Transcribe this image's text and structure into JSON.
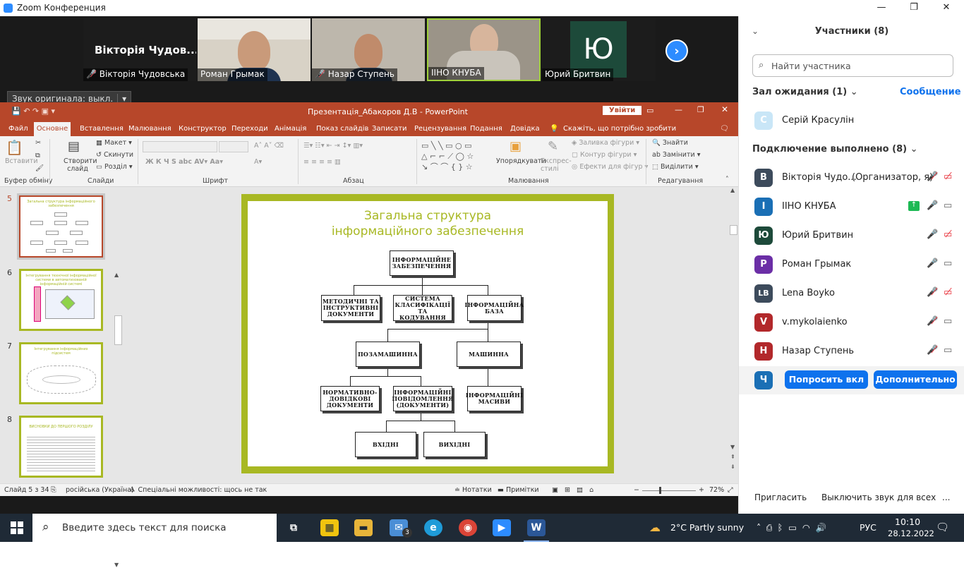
{
  "window": {
    "title": "Zoom Конференция",
    "minimize": "—",
    "restore": "❐",
    "close": "✕"
  },
  "video_strip": {
    "active_name_big": "Вікторія Чудов...",
    "tiles": [
      {
        "label": "Вікторія Чудовська",
        "muted": true
      },
      {
        "label": "Роман Грымак",
        "muted": false
      },
      {
        "label": "Назар Ступень",
        "muted": true
      },
      {
        "label": "ІІНО КНУБА",
        "muted": false
      },
      {
        "label": "Юрий Бритвин",
        "muted": false,
        "initial": "Ю"
      }
    ],
    "next_icon": "›"
  },
  "audio_button": {
    "label": "Звук оригинала: выкл.",
    "dropdown": "▾"
  },
  "ppt": {
    "title": "Презентація_Абакоров Д.В  -  PowerPoint",
    "signin": "Увійти",
    "tabs": [
      "Файл",
      "Основне",
      "Вставлення",
      "Малювання",
      "Конструктор",
      "Переходи",
      "Анімація",
      "Показ слайдів",
      "Записати",
      "Рецензування",
      "Подання",
      "Довідка"
    ],
    "tell_me": "Скажіть, що потрібно зробити",
    "ribbon": {
      "groups": [
        "Буфер обміну",
        "Слайди",
        "Шрифт",
        "Абзац",
        "Малювання",
        "Редагування"
      ],
      "paste": "Вставити",
      "new_slide": "Створити слайд",
      "layout": "Макет",
      "reset": "Скинути",
      "section": "Розділ",
      "arrange": "Упорядкувати",
      "quick_styles": "Експрес-стилі",
      "fill": "Заливка фігури",
      "outline": "Контур фігури",
      "effects": "Ефекти для фігур",
      "find": "Знайти",
      "replace": "Замінити",
      "select": "Виділити"
    },
    "thumbnails": [
      {
        "num": "5",
        "title": "Загальна структура інформаційного забезпечення"
      },
      {
        "num": "6",
        "title": "Інтегрування технічної інформаційної системи в автоматизованій інформаційній системі"
      },
      {
        "num": "7",
        "title": "Інтегрування інформаційних підсистем"
      },
      {
        "num": "8",
        "title": "ВИСНОВКИ ДО ПЕРШОГО РОЗДІЛУ"
      }
    ],
    "slide": {
      "title": "Загальна структура інформаційного забезпечення",
      "nodes": {
        "root": "ІНФОРМАЦІЙНЕ ЗАБЕЗПЕЧЕННЯ",
        "method": "МЕТОДИЧНІ ТА ІНСТРУКТИВНІ ДОКУМЕНТИ",
        "classif": "СИСТЕМА КЛАСИФІКАЦІЇ ТА КОДУВАННЯ",
        "base": "ІНФОРМАЦІЙНА БАЗА",
        "offmach": "ПОЗАМАШИННА",
        "mach": "МАШИННА",
        "norm": "НОРМАТИВНО-ДОВІДКОВІ ДОКУМЕНТИ",
        "msgs": "ІНФОРМАЦІЙНІ ПОВІДОМЛЕННЯ (ДОКУМЕНТИ)",
        "arrays": "ІНФОРМАЦІЙНІ МАСИВИ",
        "in": "ВХІДНІ",
        "out": "ВИХІДНІ"
      }
    },
    "status": {
      "slide": "Слайд 5 з 34",
      "lang": "російська (Україна)",
      "access": "Спеціальні можливості: щось не так",
      "notes": "Нотатки",
      "comments": "Примітки",
      "zoom": "72%"
    }
  },
  "panel": {
    "title": "Участники (8)",
    "search_placeholder": "Найти участника",
    "waiting_label": "Зал ожидания (1)",
    "message_btn": "Сообщение",
    "waiting": [
      {
        "initial": "С",
        "name": "Серій Красулін",
        "color": "#c9e6f7"
      }
    ],
    "connected_label": "Подключение выполнено (8)",
    "participants": [
      {
        "initial": "В",
        "name": "Вікторія Чудо...",
        "role": "(Организатор, я)",
        "color": "#3d4b5c"
      },
      {
        "initial": "І",
        "name": "ІІНО КНУБА",
        "role": "",
        "color": "#1a6fb5"
      },
      {
        "initial": "Ю",
        "name": "Юрий Бритвин",
        "role": "",
        "color": "#1d4a3a"
      },
      {
        "initial": "Р",
        "name": "Роман Грымак",
        "role": "",
        "color": "#6b2ea6"
      },
      {
        "initial": "LB",
        "name": "Lena Boyko",
        "role": "",
        "color": "#3d4b5c"
      },
      {
        "initial": "V",
        "name": "v.mykolaienko",
        "role": "",
        "color": "#b2282b"
      },
      {
        "initial": "Н",
        "name": "Назар Ступень",
        "role": "",
        "color": "#b2282b"
      },
      {
        "initial": "Ч",
        "name": "",
        "role": "",
        "color": "#1a6fb5"
      }
    ],
    "ask_unmute": "Попросить вкл",
    "more": "Дополнительно",
    "invite": "Пригласить",
    "mute_all": "Выключить звук для всех",
    "ellipsis": "..."
  },
  "taskbar": {
    "search_placeholder": "Введите здесь текст для поиска",
    "weather": "2°C  Partly sunny",
    "lang": "РУС",
    "time": "10:10",
    "date": "28.12.2022",
    "mail_badge": "3"
  }
}
